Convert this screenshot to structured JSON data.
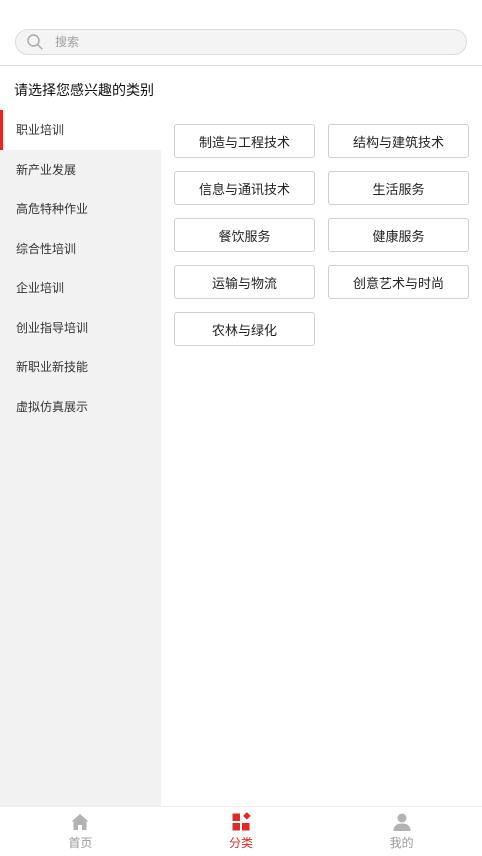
{
  "search": {
    "placeholder": "搜索"
  },
  "heading": "请选择您感兴趣的类别",
  "sidebar": {
    "items": [
      {
        "label": "职业培训",
        "active": true
      },
      {
        "label": "新产业发展"
      },
      {
        "label": "高危特种作业"
      },
      {
        "label": "综合性培训"
      },
      {
        "label": "企业培训"
      },
      {
        "label": "创业指导培训"
      },
      {
        "label": "新职业新技能"
      },
      {
        "label": "虚拟仿真展示"
      }
    ]
  },
  "categories": [
    "制造与工程技术",
    "结构与建筑技术",
    "信息与通讯技术",
    "生活服务",
    "餐饮服务",
    "健康服务",
    "运输与物流",
    "创意艺术与时尚",
    "农林与绿化"
  ],
  "tabbar": {
    "items": [
      {
        "label": "首页",
        "icon": "home-icon"
      },
      {
        "label": "分类",
        "icon": "category-icon",
        "active": true
      },
      {
        "label": "我的",
        "icon": "user-icon"
      }
    ]
  },
  "colors": {
    "accent": "#e02a2a",
    "inactive": "#999999",
    "sidebar_bg": "#f2f2f2"
  }
}
